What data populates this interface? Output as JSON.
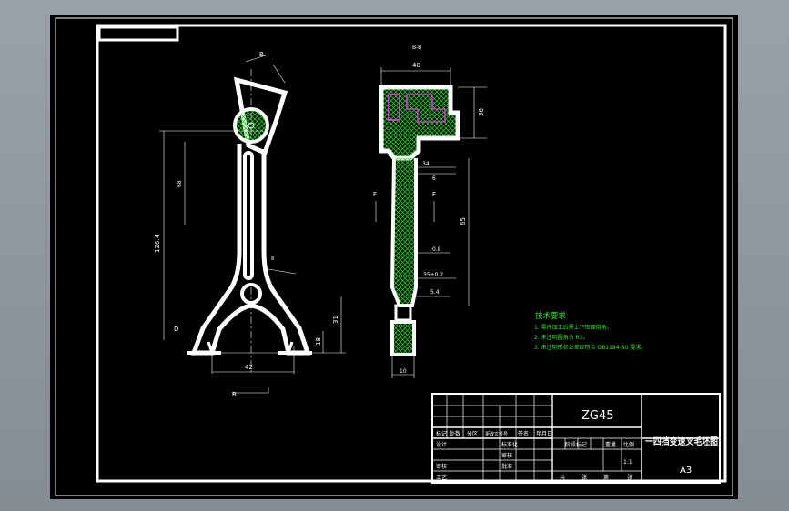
{
  "views": {
    "section_label": "B-B",
    "view_marker": "B",
    "view_marker_bottom": "B",
    "f_left": "F",
    "f_right": "F",
    "d_marker": "D"
  },
  "dimensions": {
    "d40": "40",
    "d36": "36",
    "d34": "34",
    "d6": "6",
    "d65": "65",
    "d06": "0.8",
    "d35": "35±0.2",
    "d54": "5.4",
    "d10": "10",
    "d42": "42",
    "d31": "31",
    "d18": "18",
    "d126": "126.4",
    "d8": "8",
    "d68": "68"
  },
  "tech_requirements": {
    "title": "技术要求",
    "items": [
      "1. 零件加工后需上下压面倒角。",
      "2. 未注明圆角为 R3。",
      "3. 未注明形状公差应符合 GB1184-80 要求。"
    ]
  },
  "title_block": {
    "part_code": "ZG45",
    "part_name": "一四挡变速叉毛坯图",
    "sheet_size": "A3",
    "row_labels": [
      "标记",
      "处数",
      "分区",
      "更改文件号",
      "签名",
      "年月日"
    ],
    "left_labels": [
      "设计",
      "审核",
      "工艺"
    ],
    "mid_labels": [
      "标准化",
      "审核",
      "批准"
    ],
    "stage_labels": [
      "阶段标记",
      "重量",
      "比例"
    ],
    "scale": "1:1",
    "sheets": [
      "共",
      "张",
      "第",
      "张"
    ]
  }
}
